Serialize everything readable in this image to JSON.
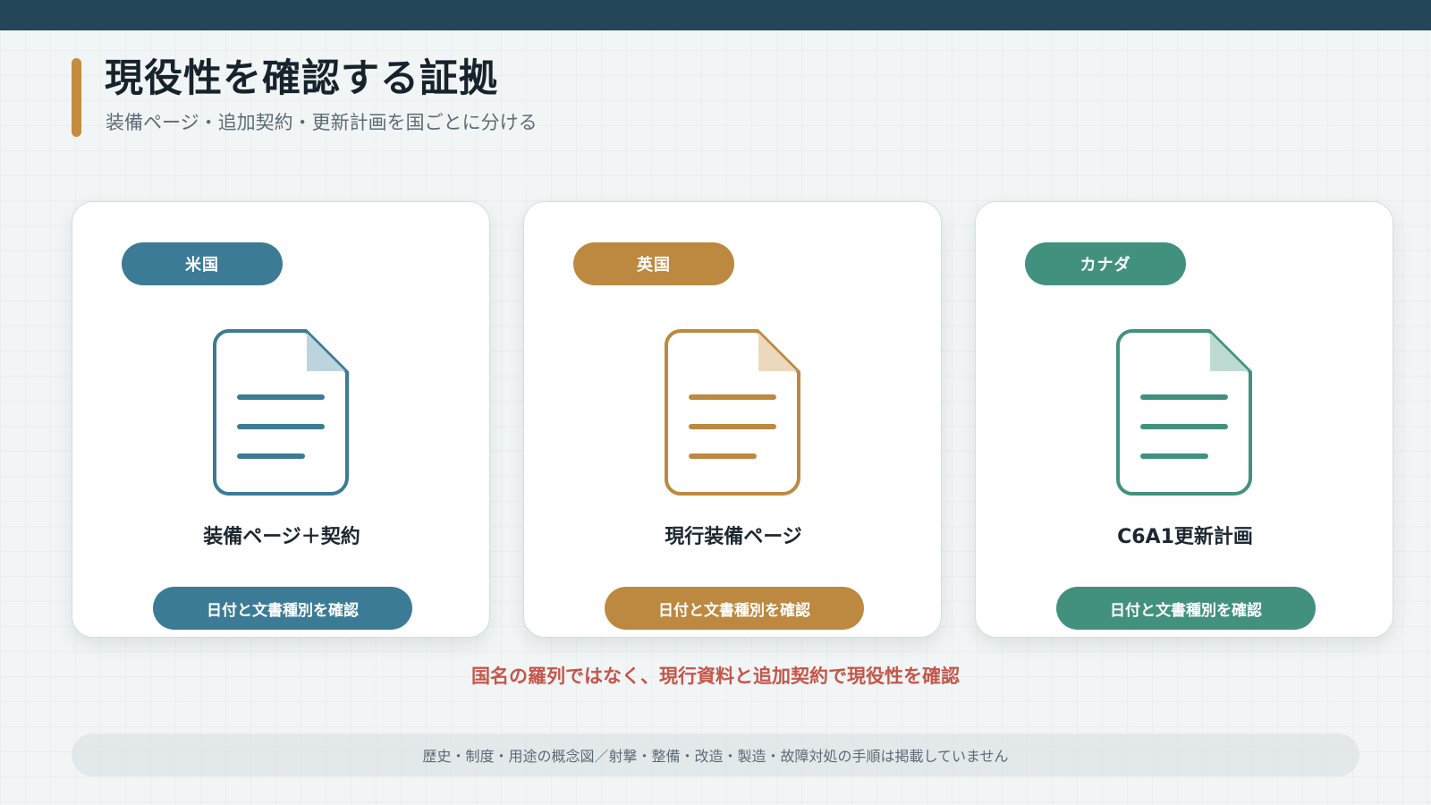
{
  "header": {
    "title": "現役性を確認する証拠",
    "subtitle": "装備ページ・追加契約・更新計画を国ごとに分ける"
  },
  "cards": [
    {
      "country": "米国",
      "doc_label": "装備ページ＋契約",
      "button_label": "日付と文書種別を確認",
      "accent_color": "#3b7b95",
      "fold_color": "#bcd5dd",
      "icon": "document-icon"
    },
    {
      "country": "英国",
      "doc_label": "現行装備ページ",
      "button_label": "日付と文書種別を確認",
      "accent_color": "#bd8840",
      "fold_color": "#ecd9bd",
      "icon": "document-icon"
    },
    {
      "country": "カナダ",
      "doc_label": "C6A1更新計画",
      "button_label": "日付と文書種別を確認",
      "accent_color": "#42917f",
      "fold_color": "#bddbd3",
      "icon": "document-icon"
    }
  ],
  "conclusion": "国名の羅列ではなく、現行資料と追加契約で現役性を確認",
  "footer_note": "歴史・制度・用途の概念図／射撃・整備・改造・製造・故障対処の手順は掲載していません",
  "colors": {
    "top_bar": "#234658",
    "title_accent": "#c58b3f",
    "conclusion_text": "#c4564a"
  }
}
